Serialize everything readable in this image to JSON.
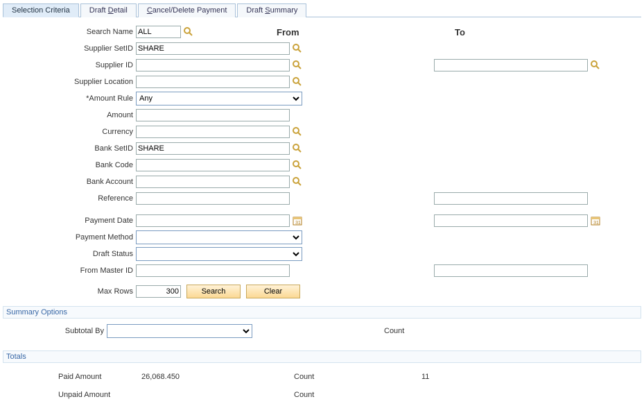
{
  "tabs": {
    "t0": "Selection Criteria",
    "t1_pre": "Draft ",
    "t1_u": "D",
    "t1_post": "etail",
    "t2_u": "C",
    "t2_post": "ancel/Delete Payment",
    "t3_pre": "Draft ",
    "t3_u": "S",
    "t3_post": "ummary"
  },
  "col": {
    "from": "From",
    "to": "To"
  },
  "labels": {
    "search_name": "Search Name",
    "supplier_setid": "Supplier SetID",
    "supplier_id": "Supplier ID",
    "supplier_location": "Supplier Location",
    "amount_rule": "*Amount Rule",
    "amount": "Amount",
    "currency": "Currency",
    "bank_setid": "Bank SetID",
    "bank_code": "Bank Code",
    "bank_account": "Bank Account",
    "reference": "Reference",
    "payment_date": "Payment Date",
    "payment_method": "Payment Method",
    "draft_status": "Draft Status",
    "from_master_id": "From Master ID",
    "max_rows": "Max Rows"
  },
  "values": {
    "search_name": "ALL",
    "supplier_setid": "SHARE",
    "supplier_id": "",
    "supplier_id_to": "",
    "supplier_location": "",
    "amount_rule": "Any",
    "amount": "",
    "currency": "",
    "bank_setid": "SHARE",
    "bank_code": "",
    "bank_account": "",
    "reference": "",
    "reference_to": "",
    "payment_date": "",
    "payment_date_to": "",
    "payment_method": "",
    "draft_status": "",
    "from_master_id": "",
    "from_master_id_to": "",
    "max_rows": "300"
  },
  "buttons": {
    "search": "Search",
    "clear": "Clear"
  },
  "summary": {
    "title": "Summary Options",
    "subtotal_by": "Subtotal By",
    "subtotal_val": "",
    "count": "Count"
  },
  "totals": {
    "title": "Totals",
    "paid_label": "Paid Amount",
    "paid_value": "26,068.450",
    "paid_count_label": "Count",
    "paid_count_value": "11",
    "unpaid_label": "Unpaid Amount",
    "unpaid_value": "",
    "unpaid_count_label": "Count",
    "unpaid_count_value": ""
  }
}
